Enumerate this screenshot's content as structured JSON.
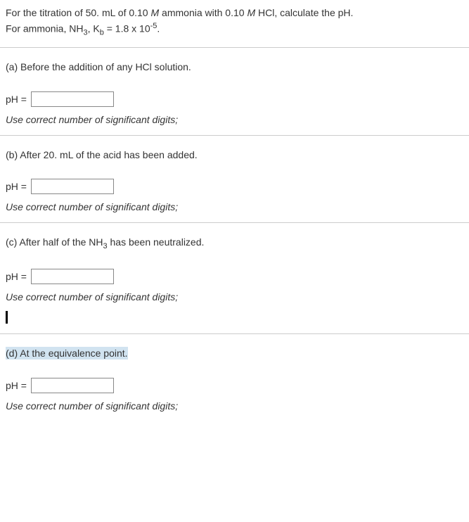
{
  "intro": {
    "line1_pre": "For the titration of 50. mL of 0.10 ",
    "line1_italic": "M",
    "line1_mid": " ammonia with 0.10 ",
    "line1_italic2": "M",
    "line1_post": " HCl, calculate the pH.",
    "line2_pre": "For ammonia, NH",
    "line2_sub1": "3",
    "line2_mid": ", K",
    "line2_sub2": "b",
    "line2_eq": " = 1.8 x 10",
    "line2_sup": "-5",
    "line2_end": "."
  },
  "questions": {
    "a": {
      "prompt": "(a) Before the addition of any HCl solution.",
      "label": "pH =",
      "hint": "Use correct number of significant digits;",
      "value": ""
    },
    "b": {
      "prompt": "(b) After 20. mL of the acid has been added.",
      "label": "pH =",
      "hint": "Use correct number of significant digits;",
      "value": ""
    },
    "c": {
      "prompt_pre": "(c) After half of the NH",
      "prompt_sub": "3",
      "prompt_post": " has been neutralized.",
      "label": "pH =",
      "hint": "Use correct number of significant digits;",
      "value": ""
    },
    "d": {
      "prompt": "(d) At the equivalence point.",
      "label": "pH =",
      "hint": "Use correct number of significant digits;",
      "value": ""
    }
  }
}
